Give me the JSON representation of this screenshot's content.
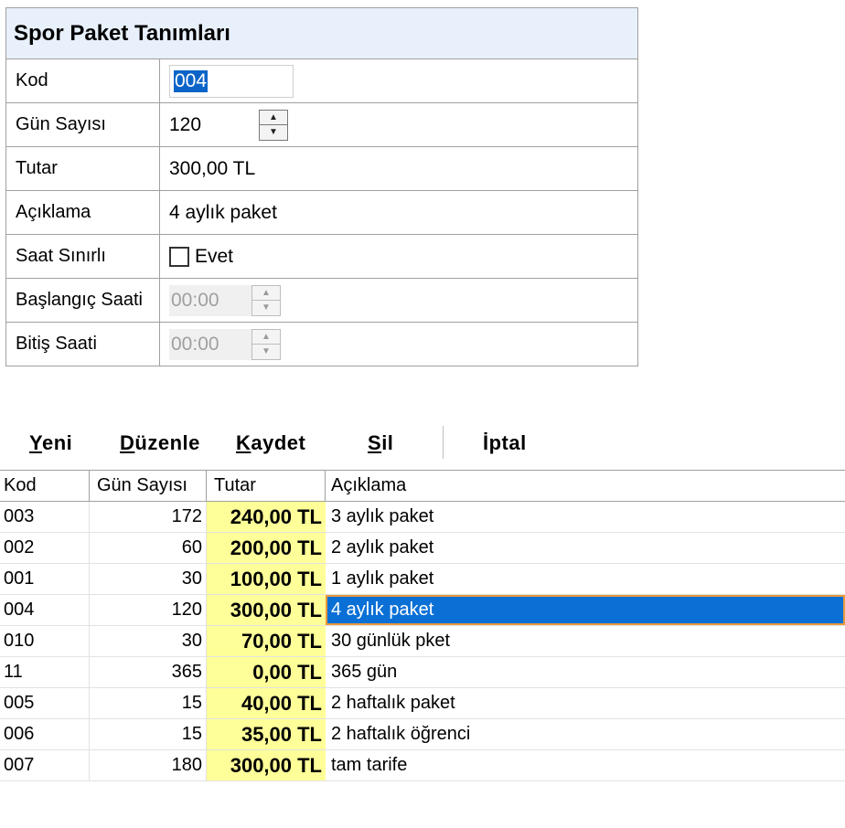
{
  "form": {
    "title": "Spor Paket Tanımları",
    "kod_label": "Kod",
    "kod_value": "004",
    "gun_label": "Gün Sayısı",
    "gun_value": "120",
    "tutar_label": "Tutar",
    "tutar_value": "300,00 TL",
    "aciklama_label": "Açıklama",
    "aciklama_value": "4 aylık paket",
    "saat_sinirli_label": "Saat Sınırlı",
    "evet_label": "Evet",
    "evet_checked": false,
    "baslangic_label": "Başlangıç Saati",
    "baslangic_value": "00:00",
    "bitis_label": "Bitiş Saati",
    "bitis_value": "00:00"
  },
  "toolbar": {
    "yeni_first": "Y",
    "yeni_rest": "eni",
    "duzenle_first": "D",
    "duzenle_rest": "üzenle",
    "kaydet_first": "K",
    "kaydet_rest": "aydet",
    "sil_first": "S",
    "sil_rest": "il",
    "iptal": "İptal"
  },
  "grid": {
    "headers": [
      "Kod",
      "Gün Sayısı",
      "Tutar",
      "Açıklama"
    ],
    "rows": [
      {
        "kod": "003",
        "gun": "172",
        "tutar": "240,00 TL",
        "aciklama": "3 aylık paket"
      },
      {
        "kod": "002",
        "gun": "60",
        "tutar": "200,00 TL",
        "aciklama": "2 aylık paket"
      },
      {
        "kod": "001",
        "gun": "30",
        "tutar": "100,00 TL",
        "aciklama": "1 aylık paket"
      },
      {
        "kod": "004",
        "gun": "120",
        "tutar": "300,00 TL",
        "aciklama": "4 aylık paket"
      },
      {
        "kod": "010",
        "gun": "30",
        "tutar": "70,00 TL",
        "aciklama": "30 günlük pket"
      },
      {
        "kod": "11",
        "gun": "365",
        "tutar": "0,00 TL",
        "aciklama": "365 gün"
      },
      {
        "kod": "005",
        "gun": "15",
        "tutar": "40,00 TL",
        "aciklama": "2 haftalık paket"
      },
      {
        "kod": "006",
        "gun": "15",
        "tutar": "35,00 TL",
        "aciklama": "2 haftalık öğrenci"
      },
      {
        "kod": "007",
        "gun": "180",
        "tutar": "300,00 TL",
        "aciklama": "tam tarife"
      }
    ],
    "selected_kod": "004"
  },
  "colors": {
    "title_bg": "#e8f1fb",
    "tutar_bg": "#ffff99",
    "selection": "#0a70d6",
    "selection_border": "#e89a3c"
  }
}
